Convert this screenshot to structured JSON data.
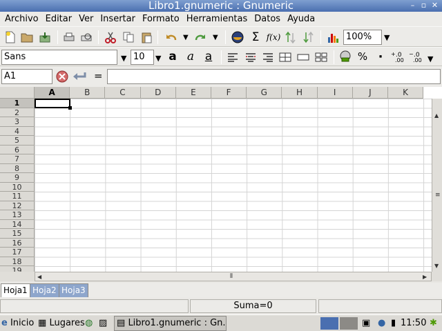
{
  "window": {
    "title": "Libro1.gnumeric : Gnumeric",
    "minimize_icon": "minimize-icon",
    "maximize_icon": "maximize-icon",
    "close_icon": "close-icon"
  },
  "menu": {
    "items": [
      "Archivo",
      "Editar",
      "Ver",
      "Insertar",
      "Formato",
      "Herramientas",
      "Datos",
      "Ayuda"
    ]
  },
  "toolbar": {
    "zoom": "100%"
  },
  "format_toolbar": {
    "font_name": "Sans",
    "font_size": "10",
    "bold_glyph": "a",
    "italic_glyph": "a",
    "underline_glyph": "a",
    "percent_glyph": "%",
    "thousands_glyph": "·"
  },
  "formula_bar": {
    "cell_ref": "A1",
    "equals": "=",
    "value": ""
  },
  "sheet": {
    "columns": [
      "A",
      "B",
      "C",
      "D",
      "E",
      "F",
      "G",
      "H",
      "I",
      "J",
      "K"
    ],
    "rows": [
      "1",
      "2",
      "3",
      "4",
      "5",
      "6",
      "7",
      "8",
      "9",
      "10",
      "11",
      "12",
      "13",
      "14",
      "15",
      "16",
      "17",
      "18",
      "19"
    ],
    "active_column": "A",
    "active_row": "1"
  },
  "tabs": [
    "Hoja1",
    "Hoja2",
    "Hoja3"
  ],
  "status": {
    "sum": "Suma=0"
  },
  "taskbar": {
    "start": "Inicio",
    "places": "Lugares",
    "task": "Libro1.gnumeric : Gn...",
    "clock": "11:50"
  },
  "colors": {
    "title_bar": "#4a6fb0",
    "inactive_tab": "#8ea6cc",
    "header_bg": "#dcdad5"
  }
}
